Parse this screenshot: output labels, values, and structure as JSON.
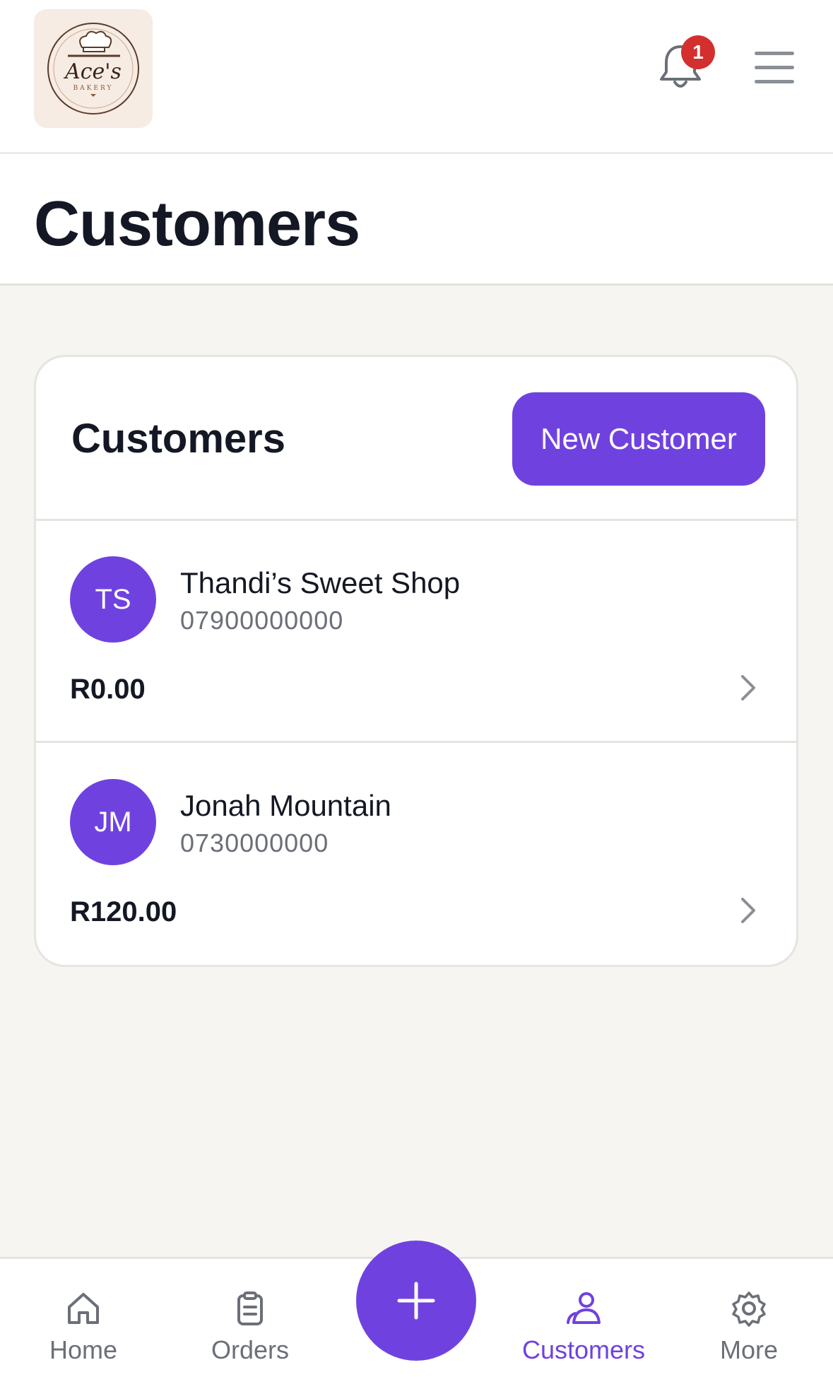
{
  "app": {
    "logo_text": "Ace's",
    "logo_subtext": "BAKERY",
    "notification_count": "1"
  },
  "page": {
    "title": "Customers"
  },
  "card": {
    "title": "Customers",
    "new_button_label": "New Customer"
  },
  "customers": [
    {
      "initials": "TS",
      "name": "Thandi’s Sweet Shop",
      "phone": "07900000000",
      "balance": "R0.00"
    },
    {
      "initials": "JM",
      "name": "Jonah Mountain",
      "phone": "0730000000",
      "balance": "R120.00"
    }
  ],
  "bottom_nav": {
    "items": [
      {
        "label": "Home",
        "icon": "home-icon"
      },
      {
        "label": "Orders",
        "icon": "clipboard-icon"
      },
      {
        "label": "Customers",
        "icon": "users-icon",
        "active": true
      },
      {
        "label": "More",
        "icon": "gear-icon"
      }
    ],
    "fab_icon": "plus-icon"
  },
  "colors": {
    "accent": "#6f42e0",
    "badge": "#d32f2f",
    "background": "#f7f5f1"
  }
}
